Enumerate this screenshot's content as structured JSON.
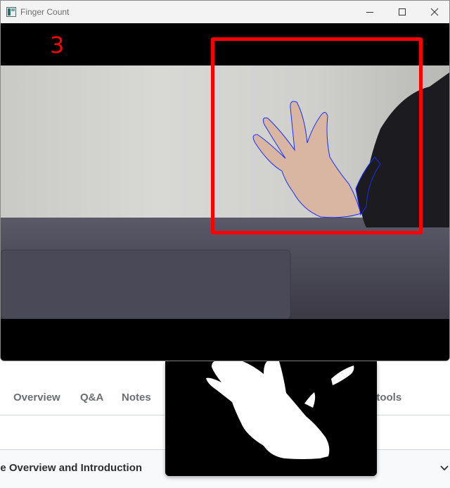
{
  "window": {
    "title": "Finger Count",
    "finger_count": "3"
  },
  "background_page": {
    "tabs": [
      "Overview",
      "Q&A",
      "Notes",
      "g tools"
    ],
    "section_title": "se Overview and Introduction"
  },
  "colors": {
    "roi_box": "#ff0000",
    "count_text": "#ff0000",
    "contour": "#1a2cff"
  },
  "icons": {
    "minimize": "minimize-icon",
    "maximize": "maximize-icon",
    "close": "close-icon",
    "app": "app-window-icon",
    "chevron": "chevron-down-icon"
  }
}
